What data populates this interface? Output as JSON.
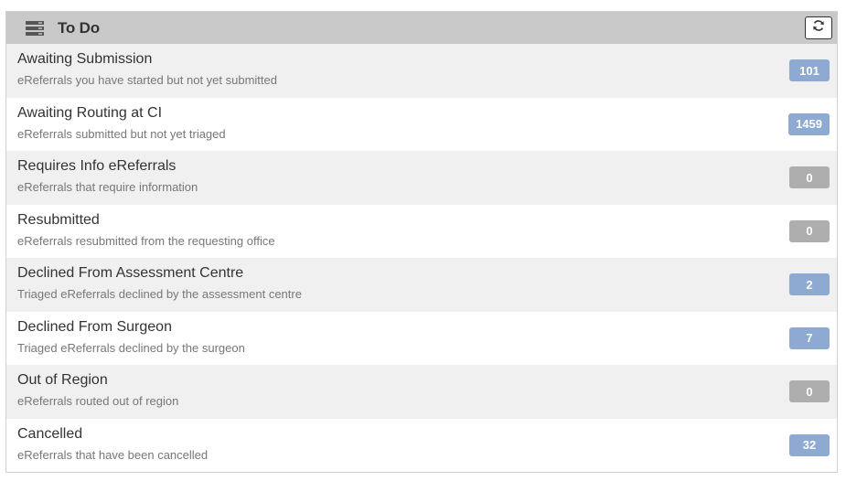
{
  "header": {
    "title": "To Do",
    "icon": "server-list-icon",
    "refresh_icon": "refresh-icon"
  },
  "colors": {
    "badge_active": "#8eaad3",
    "badge_zero": "#aeaeae"
  },
  "items": [
    {
      "title": "Awaiting Submission",
      "description": "eReferrals you have started but not yet submitted",
      "count": "101",
      "active": true
    },
    {
      "title": "Awaiting Routing at CI",
      "description": "eReferrals submitted but not yet triaged",
      "count": "1459",
      "active": true
    },
    {
      "title": "Requires Info eReferrals",
      "description": "eReferrals that require information",
      "count": "0",
      "active": false
    },
    {
      "title": "Resubmitted",
      "description": "eReferrals resubmitted from the requesting office",
      "count": "0",
      "active": false
    },
    {
      "title": "Declined From Assessment Centre",
      "description": "Triaged eReferrals declined by the assessment centre",
      "count": "2",
      "active": true
    },
    {
      "title": "Declined From Surgeon",
      "description": "Triaged eReferrals declined by the surgeon",
      "count": "7",
      "active": true
    },
    {
      "title": "Out of Region",
      "description": "eReferrals routed out of region",
      "count": "0",
      "active": false
    },
    {
      "title": "Cancelled",
      "description": "eReferrals that have been cancelled",
      "count": "32",
      "active": true
    }
  ]
}
